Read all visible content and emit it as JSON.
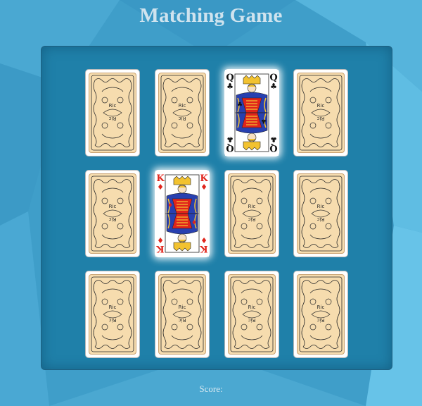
{
  "title": "Matching Game",
  "score_label": "Score:",
  "colors": {
    "background": "#3f9ec9",
    "board": "#1f80a9",
    "card_back": "#f6dcae",
    "card_back_ink": "#2a2a2a",
    "red_suit": "#e0241b",
    "black_suit": "#111111"
  },
  "board": {
    "rows": 3,
    "cols": 4,
    "cards": [
      {
        "state": "face-down"
      },
      {
        "state": "face-down"
      },
      {
        "state": "face-up",
        "rank": "Q",
        "suit": "clubs",
        "suit_symbol": "♣",
        "color": "black"
      },
      {
        "state": "face-down"
      },
      {
        "state": "face-down"
      },
      {
        "state": "face-up",
        "rank": "K",
        "suit": "diamonds",
        "suit_symbol": "♦",
        "color": "red"
      },
      {
        "state": "face-down"
      },
      {
        "state": "face-down"
      },
      {
        "state": "face-down"
      },
      {
        "state": "face-down"
      },
      {
        "state": "face-down"
      },
      {
        "state": "face-down"
      }
    ]
  },
  "card_back_text": "Ric"
}
